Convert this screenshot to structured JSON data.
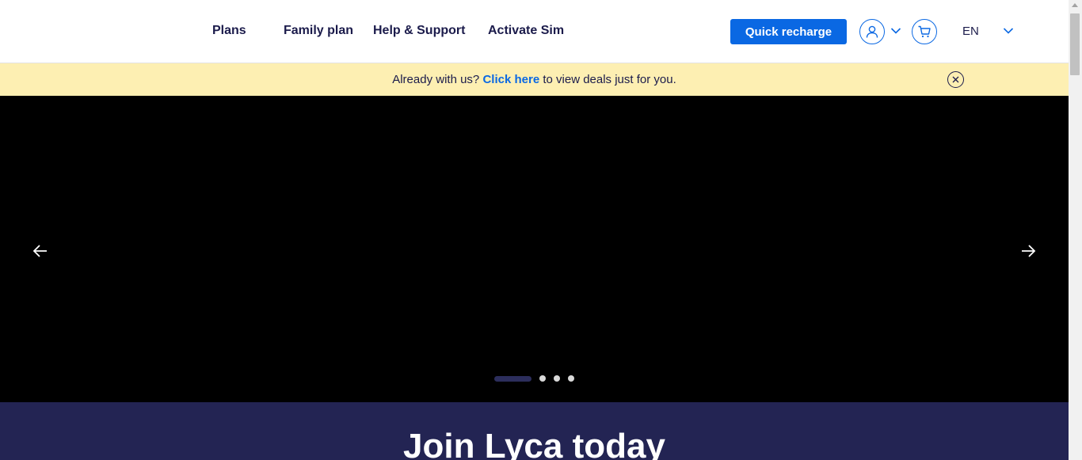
{
  "header": {
    "nav": [
      {
        "label": "Plans"
      },
      {
        "label": "Family plan"
      },
      {
        "label": "Help & Support"
      },
      {
        "label": "Activate Sim"
      }
    ],
    "quick_recharge_label": "Quick recharge",
    "language": "EN",
    "icons": {
      "account": "user-icon",
      "cart": "cart-icon",
      "dropdown": "chevron-down-icon"
    }
  },
  "banner": {
    "text_before": "Already with us?",
    "link_text": "Click here",
    "text_after": "to view deals just for you.",
    "close_icon": "close-icon"
  },
  "hero": {
    "slides_total": 4,
    "active_slide": 1,
    "prev_icon": "arrow-left-icon",
    "next_icon": "arrow-right-icon"
  },
  "join": {
    "title": "Join Lyca today"
  },
  "colors": {
    "primary": "#0a68e3",
    "navy": "#1b1b4b",
    "banner_bg": "#fdefb2",
    "hero_bg": "#000000",
    "join_bg": "#232453"
  }
}
